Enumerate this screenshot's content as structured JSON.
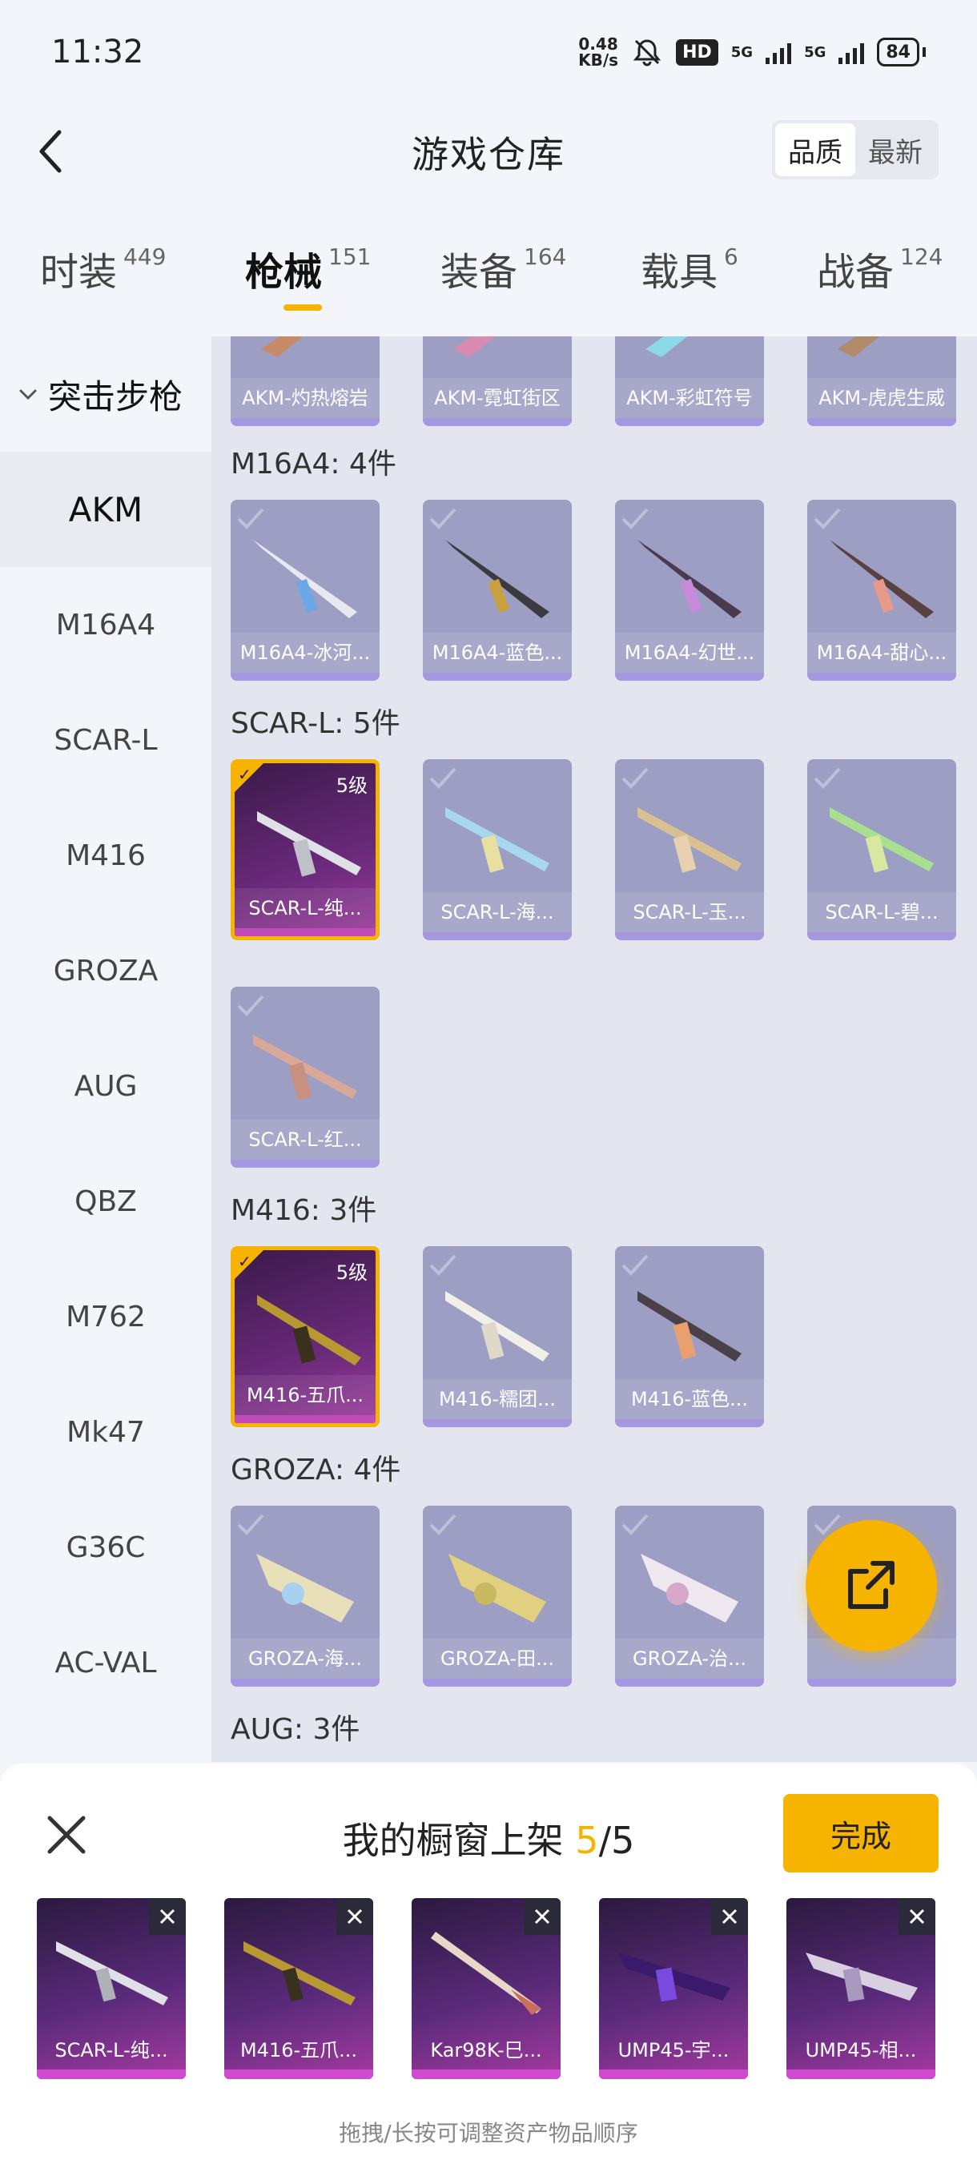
{
  "status_bar": {
    "time": "11:32",
    "net_speed_value": "0.48",
    "net_speed_unit": "KB/s",
    "hd_label": "HD",
    "signal1": "5G",
    "signal2": "5G",
    "battery": "84",
    "icons": [
      "mute-bell-icon",
      "signal-icon",
      "battery-icon"
    ]
  },
  "header": {
    "title": "游戏仓库",
    "sort_options": [
      "品质",
      "最新"
    ],
    "sort_selected": "品质"
  },
  "tabs": [
    {
      "label": "时装",
      "count": "449"
    },
    {
      "label": "枪械",
      "count": "151"
    },
    {
      "label": "装备",
      "count": "164"
    },
    {
      "label": "载具",
      "count": "6"
    },
    {
      "label": "战备",
      "count": "124"
    }
  ],
  "active_tab": "枪械",
  "sidebar": {
    "category": "突击步枪",
    "items": [
      "AKM",
      "M16A4",
      "SCAR-L",
      "M416",
      "GROZA",
      "AUG",
      "QBZ",
      "M762",
      "Mk47",
      "G36C",
      "AC-VAL"
    ],
    "active": "AKM"
  },
  "groups": {
    "akm": {
      "items": [
        "AKM-灼热熔岩",
        "AKM-霓虹街区",
        "AKM-彩虹符号",
        "AKM-虎虎生威"
      ]
    },
    "m16a4": {
      "title": "M16A4: 4件",
      "items": [
        "M16A4-冰河...",
        "M16A4-蓝色...",
        "M16A4-幻世...",
        "M16A4-甜心..."
      ]
    },
    "scarl": {
      "title": "SCAR-L: 5件",
      "items": [
        "SCAR-L-纯...",
        "SCAR-L-海...",
        "SCAR-L-玉...",
        "SCAR-L-碧...",
        "SCAR-L-红..."
      ],
      "level": "5级"
    },
    "m416": {
      "title": "M416: 3件",
      "items": [
        "M416-五爪...",
        "M416-糯团...",
        "M416-蓝色..."
      ],
      "level": "5级"
    },
    "groza": {
      "title": "GROZA: 4件",
      "items": [
        "GROZA-海...",
        "GROZA-田...",
        "GROZA-治...",
        ""
      ]
    },
    "aug": {
      "title": "AUG: 3件"
    }
  },
  "fab": {
    "icon": "share-external-icon"
  },
  "showcase": {
    "title_prefix": "我的橱窗上架",
    "current": "5",
    "separator": "/",
    "total": "5",
    "done_label": "完成",
    "items": [
      "SCAR-L-纯...",
      "M416-五爪...",
      "Kar98K-巳...",
      "UMP45-宇...",
      "UMP45-相..."
    ],
    "hint": "拖拽/长按可调整资产物品顺序"
  },
  "colors": {
    "accent": "#f6b400",
    "card_normal": "#9d9ec3",
    "card_epic": "#6a2a7a",
    "text": "#222222"
  }
}
